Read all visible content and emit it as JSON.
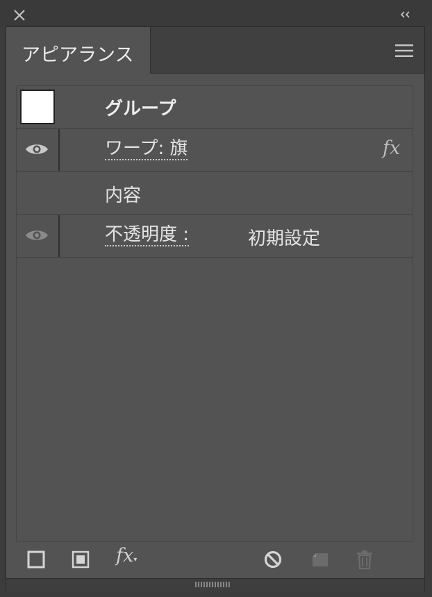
{
  "window": {
    "close_icon": "close-icon",
    "collapse_label": "‹‹"
  },
  "tab": {
    "label": "アピアランス",
    "menu_icon": "hamburger-menu-icon"
  },
  "rows": [
    {
      "label": "グループ",
      "thumbnail": "white"
    },
    {
      "label": "ワープ: 旗",
      "visible": true,
      "fx": "fx"
    },
    {
      "label": "内容"
    },
    {
      "label": "不透明度 :",
      "value": "初期設定",
      "visible": true
    }
  ],
  "footer": {
    "fx_label": "fx",
    "icons": [
      "add-new-stroke-icon",
      "add-new-fill-icon",
      "add-effect-icon",
      "clear-appearance-icon",
      "duplicate-item-icon",
      "delete-item-icon"
    ]
  },
  "colors": {
    "panel": "#535353",
    "titlebar": "#3a3a3a",
    "text": "#e4e4e4"
  }
}
